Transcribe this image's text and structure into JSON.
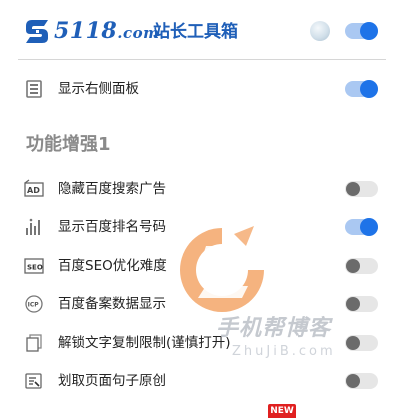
{
  "header": {
    "logo_number": "5118",
    "logo_domain": ".com",
    "title": "站长工具箱",
    "master_toggle_on": true
  },
  "panel_row": {
    "label": "显示右侧面板",
    "icon": "panel-icon",
    "on": true
  },
  "section": {
    "title": "功能增强1",
    "items": [
      {
        "label": "隐藏百度搜索广告",
        "icon": "ad-icon",
        "on": false
      },
      {
        "label": "显示百度排名号码",
        "icon": "bar-chart-icon",
        "on": true
      },
      {
        "label": "百度SEO优化难度",
        "icon": "seo-icon",
        "on": false
      },
      {
        "label": "百度备案数据显示",
        "icon": "icp-icon",
        "on": false
      },
      {
        "label": "解锁文字复制限制(谨慎打开)",
        "icon": "copy-icon",
        "on": false
      },
      {
        "label": "划取页面句子原创",
        "icon": "text-select-icon",
        "on": false
      }
    ]
  },
  "watermark": {
    "text": "手机帮博客",
    "url": "ZhuJiB.com"
  },
  "badge": "NEW",
  "colors": {
    "brand": "#1f5fb8",
    "toggle_on": "#1e73e8",
    "toggle_on_track": "#aac8f2",
    "toggle_off_track": "#e6e6e6",
    "toggle_off_knob": "#6b6b6b",
    "watermark_orange": "#f08a3a"
  }
}
